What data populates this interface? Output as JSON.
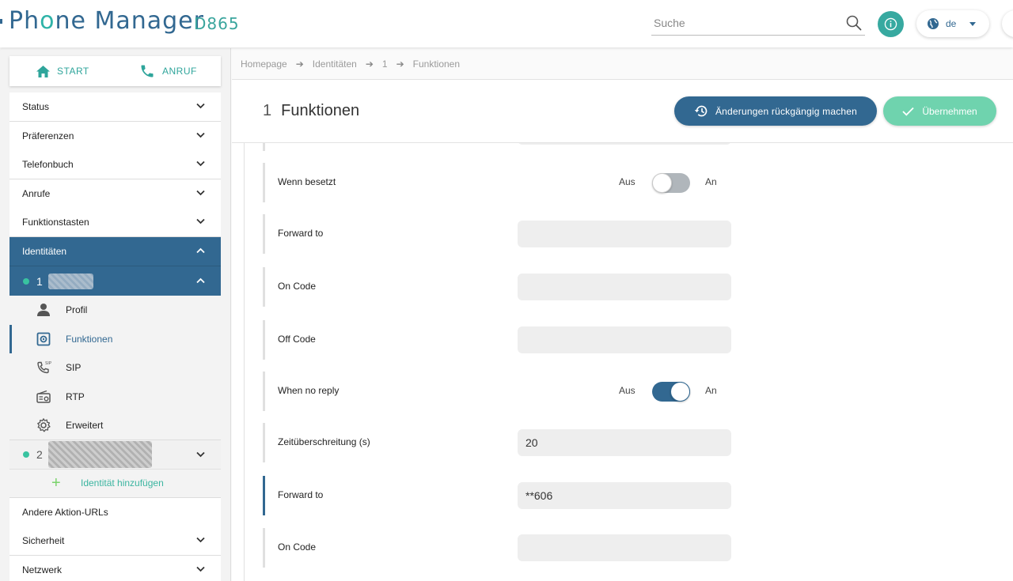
{
  "header": {
    "brand_part1": "Ph",
    "brand_accent": "o",
    "brand_part2": "ne Manager",
    "model": "D865",
    "search_placeholder": "Suche",
    "language": "de"
  },
  "quick_actions": {
    "start": "START",
    "call": "ANRUF"
  },
  "sidebar": {
    "items": [
      {
        "label": "Status"
      },
      {
        "label": "Präferenzen"
      },
      {
        "label": "Telefonbuch"
      },
      {
        "label": "Anrufe"
      },
      {
        "label": "Funktionstasten"
      },
      {
        "label": "Identitäten"
      }
    ],
    "identity_1": {
      "number": "1"
    },
    "identity_1_subitems": [
      {
        "label": "Profil",
        "icon": "person-icon"
      },
      {
        "label": "Funktionen",
        "icon": "function-settings-icon"
      },
      {
        "label": "SIP",
        "icon": "sip-phone-icon"
      },
      {
        "label": "RTP",
        "icon": "radio-icon"
      },
      {
        "label": "Erweitert",
        "icon": "gear-icon"
      }
    ],
    "identity_2": {
      "number": "2"
    },
    "add_identity": "Identität hinzufügen",
    "items_after": [
      {
        "label": "Andere Aktion-URLs"
      },
      {
        "label": "Sicherheit"
      },
      {
        "label": "Netzwerk"
      }
    ]
  },
  "breadcrumb": [
    "Homepage",
    "Identitäten",
    "1",
    "Funktionen"
  ],
  "page": {
    "number": "1",
    "title": "Funktionen",
    "revert_label": "Änderungen rückgängig machen",
    "apply_label": "Übernehmen"
  },
  "form": {
    "toggle_off_label": "Aus",
    "toggle_on_label": "An",
    "rows": [
      {
        "label": "Wenn besetzt",
        "type": "toggle",
        "value": "off"
      },
      {
        "label": "Forward to",
        "type": "text",
        "value": ""
      },
      {
        "label": "On Code",
        "type": "text",
        "value": ""
      },
      {
        "label": "Off Code",
        "type": "text",
        "value": ""
      },
      {
        "label": "When no reply",
        "type": "toggle",
        "value": "on"
      },
      {
        "label": "Zeitüberschreitung (s)",
        "type": "text",
        "value": "20"
      },
      {
        "label": "Forward to",
        "type": "text",
        "value": "**606"
      },
      {
        "label": "On Code",
        "type": "text",
        "value": ""
      }
    ]
  },
  "colors": {
    "primary": "#326891",
    "accent": "#37a9a0",
    "apply": "#6fd3ae",
    "status_dot": "#39c3a0"
  }
}
